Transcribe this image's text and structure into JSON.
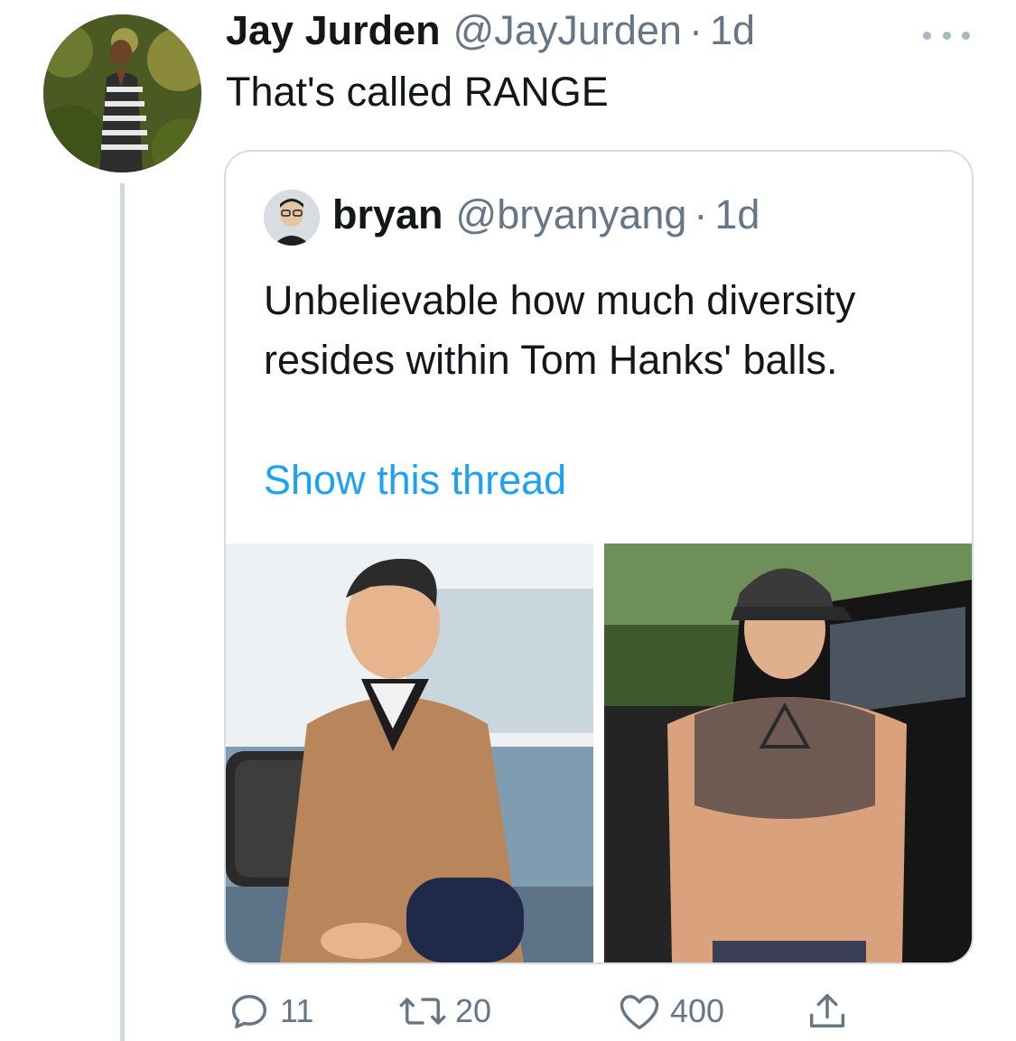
{
  "tweet": {
    "author": {
      "display_name": "Jay Jurden",
      "handle": "@JayJurden",
      "separator": "·",
      "time": "1d"
    },
    "text": "That's called RANGE",
    "more_icon": "more-horizontal-icon"
  },
  "quote": {
    "author": {
      "display_name": "bryan",
      "handle": "@bryanyang",
      "separator": "·",
      "time": "1d"
    },
    "text": "Unbelievable how much diversity resides within Tom Hanks' balls.",
    "thread_link": "Show this thread"
  },
  "actions": {
    "reply": {
      "icon": "reply-icon",
      "count": "11"
    },
    "retweet": {
      "icon": "retweet-icon",
      "count": "20"
    },
    "like": {
      "icon": "heart-icon",
      "count": "400"
    },
    "share": {
      "icon": "share-icon",
      "count": ""
    }
  },
  "colors": {
    "text": "#14171a",
    "secondary": "#657786",
    "link": "#1da1f2",
    "border": "#d6dde2",
    "icon": "#657786"
  }
}
